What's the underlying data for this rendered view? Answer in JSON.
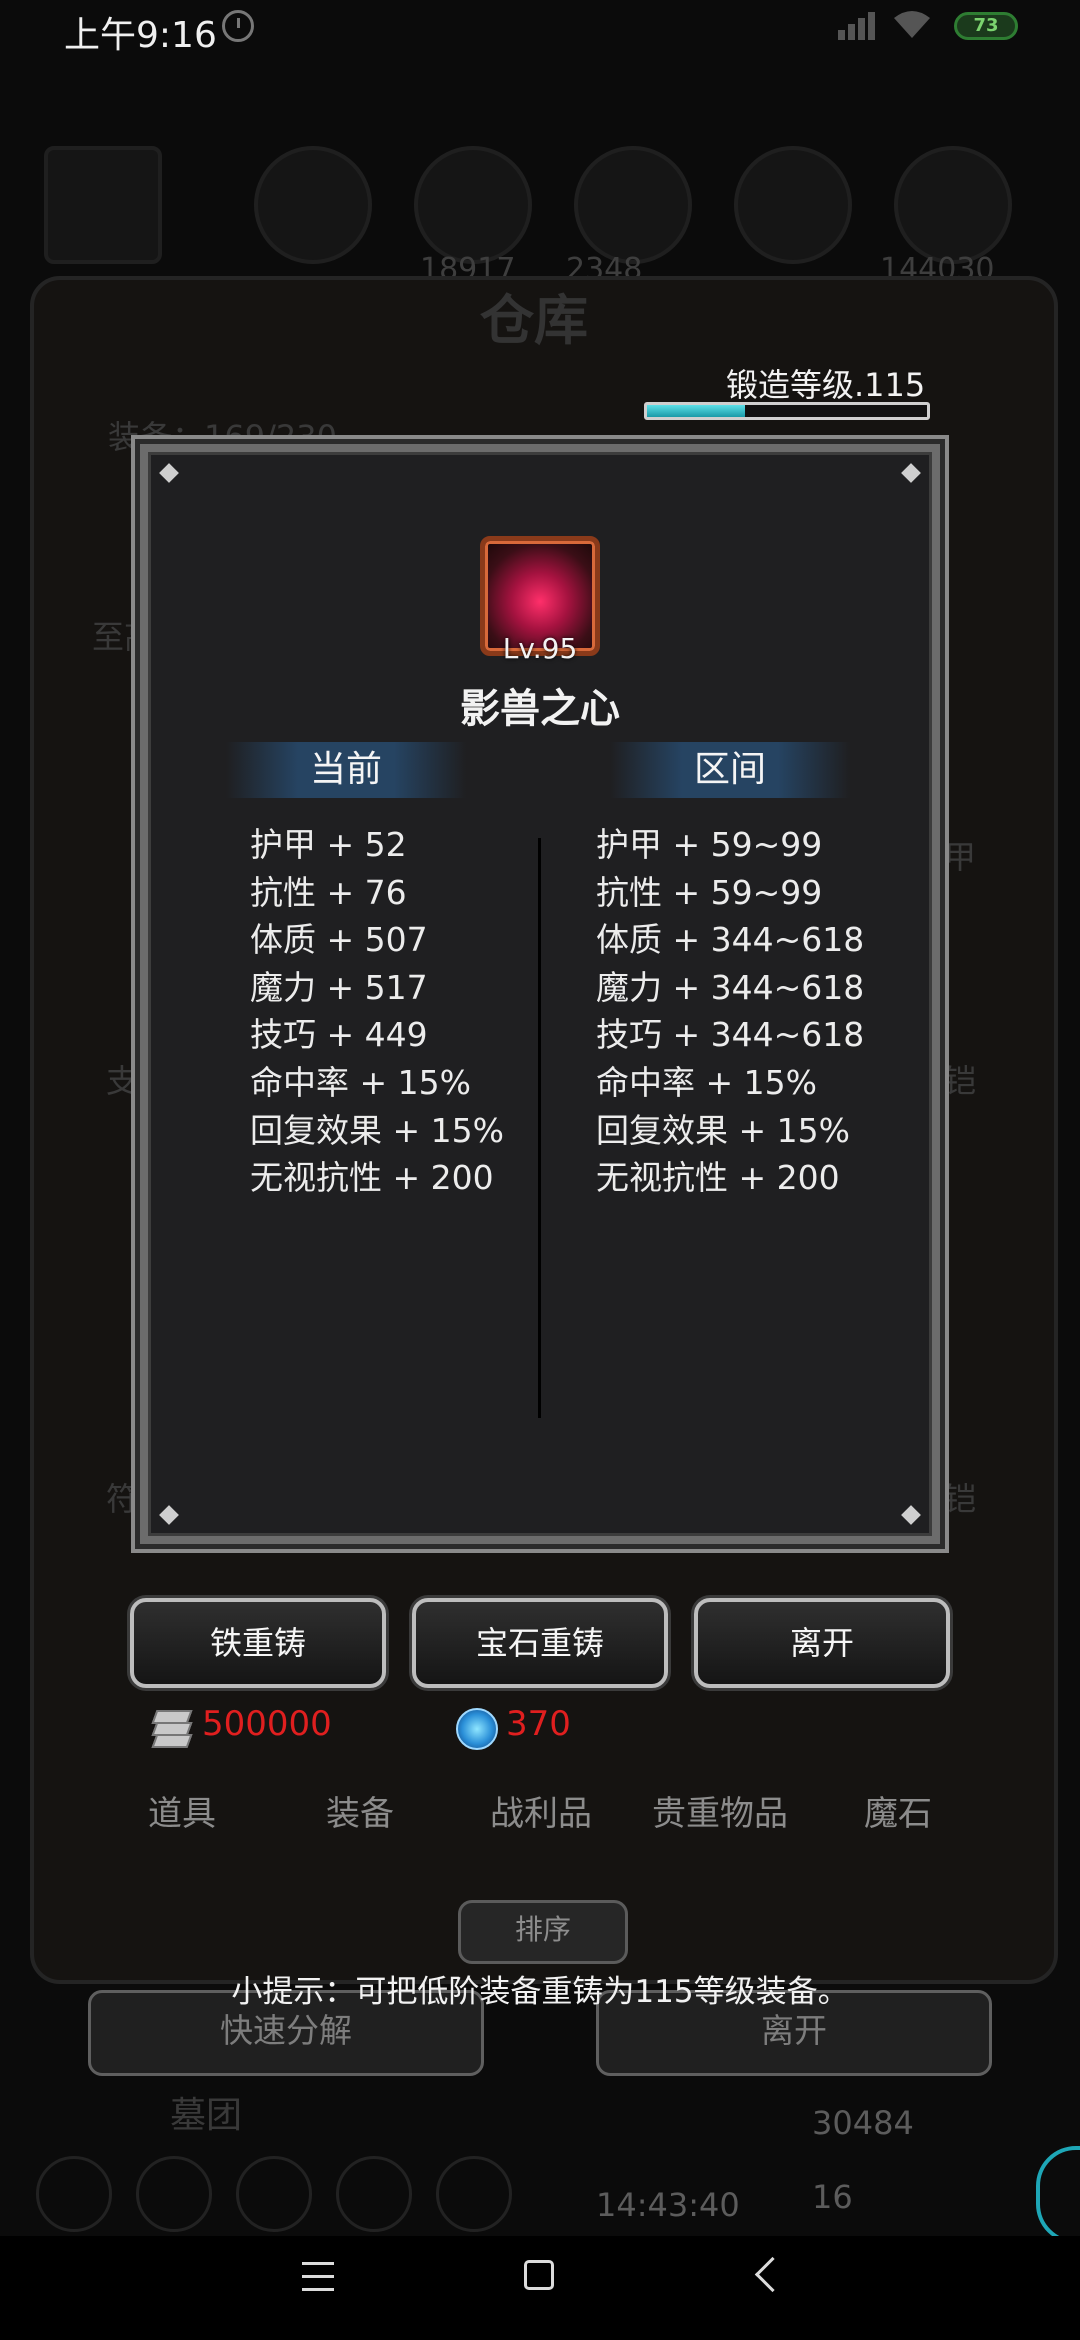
{
  "status_bar": {
    "time": "上午9:16",
    "battery": "73"
  },
  "background": {
    "title": "仓库",
    "stats": [
      "18917",
      "2348",
      "144030"
    ],
    "labels": [
      "装备：169/230",
      "至高",
      "支",
      "符",
      "甲",
      "铠",
      "铠"
    ],
    "bottom_buttons": [
      "快速分解",
      "离开"
    ],
    "guild": "墓团",
    "timer": "14:43:40",
    "gold": "30484",
    "gem_count": "16"
  },
  "forge": {
    "label": "锻造等级.115",
    "progress": 0.35
  },
  "item": {
    "level": "Lv.95",
    "name": "影兽之心",
    "icon": "crimson-dragon-heart-icon"
  },
  "columns": {
    "current_header": "当前",
    "range_header": "区间"
  },
  "current_stats": [
    "护甲 + 52",
    "抗性 + 76",
    "体质 + 507",
    "魔力 + 517",
    "技巧 + 449",
    "命中率 + 15%",
    "回复效果 + 15%",
    "无视抗性 + 200"
  ],
  "range_stats": [
    "护甲 + 59~99",
    "抗性 + 59~99",
    "体质 + 344~618",
    "魔力 + 344~618",
    "技巧 + 344~618",
    "命中率 + 15%",
    "回复效果 + 15%",
    "无视抗性 + 200"
  ],
  "actions": {
    "iron_reforge": "铁重铸",
    "gem_reforge": "宝石重铸",
    "leave": "离开"
  },
  "currency": {
    "iron": "500000",
    "gem": "370",
    "color": "#e01f1f"
  },
  "tabs": [
    "道具",
    "装备",
    "战利品",
    "贵重物品",
    "魔石"
  ],
  "sort_label": "排序",
  "tip": "小提示：可把低阶装备重铸为115等级装备。"
}
